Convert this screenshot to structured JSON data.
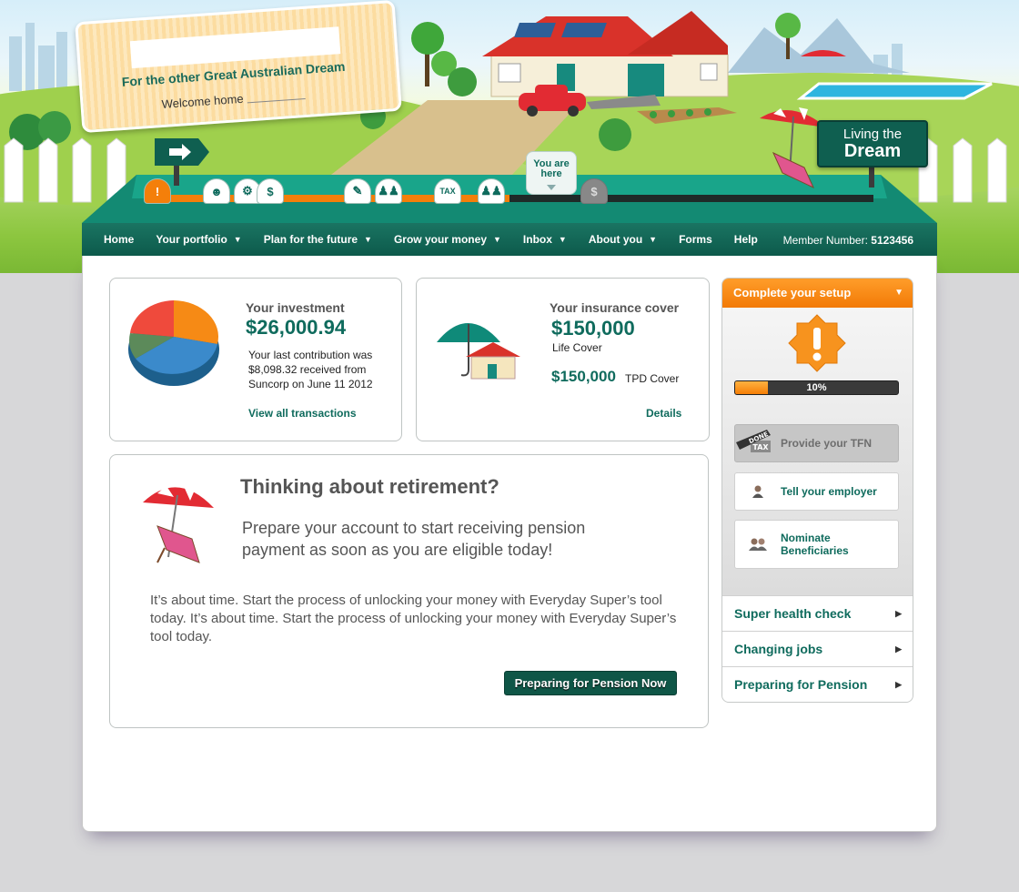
{
  "hero": {
    "tagline": "For the other Great Australian Dream",
    "welcome": "Welcome home",
    "dream_line1": "Living the",
    "dream_line2": "Dream",
    "you_are_here_1": "You are",
    "you_are_here_2": "here",
    "steps": [
      "!",
      "person",
      "robot",
      "$",
      "pencil",
      "people",
      "TAX",
      "people",
      "you-are-here",
      "$"
    ]
  },
  "nav": {
    "items": [
      {
        "label": "Home",
        "dropdown": false
      },
      {
        "label": "Your portfolio",
        "dropdown": true
      },
      {
        "label": "Plan for the future",
        "dropdown": true
      },
      {
        "label": "Grow your money",
        "dropdown": true
      },
      {
        "label": "Inbox",
        "dropdown": true
      },
      {
        "label": "About you",
        "dropdown": true
      },
      {
        "label": "Forms",
        "dropdown": false
      },
      {
        "label": "Help",
        "dropdown": false
      }
    ],
    "member_label": "Member Number:",
    "member_number": "5123456"
  },
  "investment": {
    "label": "Your investment",
    "amount": "$26,000.94",
    "text_l1": "Your last contribution was",
    "text_l2": "$8,098.32 received from",
    "text_l3": "Suncorp on June 11 2012",
    "link": "View all transactions"
  },
  "insurance": {
    "label": "Your insurance cover",
    "life_amount": "$150,000",
    "life_label": "Life Cover",
    "tpd_amount": "$150,000",
    "tpd_label": "TPD Cover",
    "link": "Details"
  },
  "retirement": {
    "title": "Thinking about retirement?",
    "subtitle": "Prepare your account to start receiving pension payment as soon as you are eligible today!",
    "body": "It’s about time. Start the process of unlocking your money with Everyday Super’s tool today. It’s about time. Start the process of unlocking your money with Everyday Super’s tool today.",
    "button": "Preparing for Pension Now"
  },
  "setup": {
    "title": "Complete your setup",
    "progress_label": "10%",
    "progress_fraction": 0.2,
    "done_badge": "DONE",
    "tax_badge": "TAX",
    "tasks": [
      "Provide your TFN",
      "Tell your employer",
      "Nominate Beneficiaries"
    ],
    "links": [
      "Super health check",
      "Changing jobs",
      "Preparing for Pension"
    ]
  },
  "colors": {
    "brand": "#0f6b5d",
    "accent": "#f47f0a",
    "nav": "#0d5a4b"
  }
}
